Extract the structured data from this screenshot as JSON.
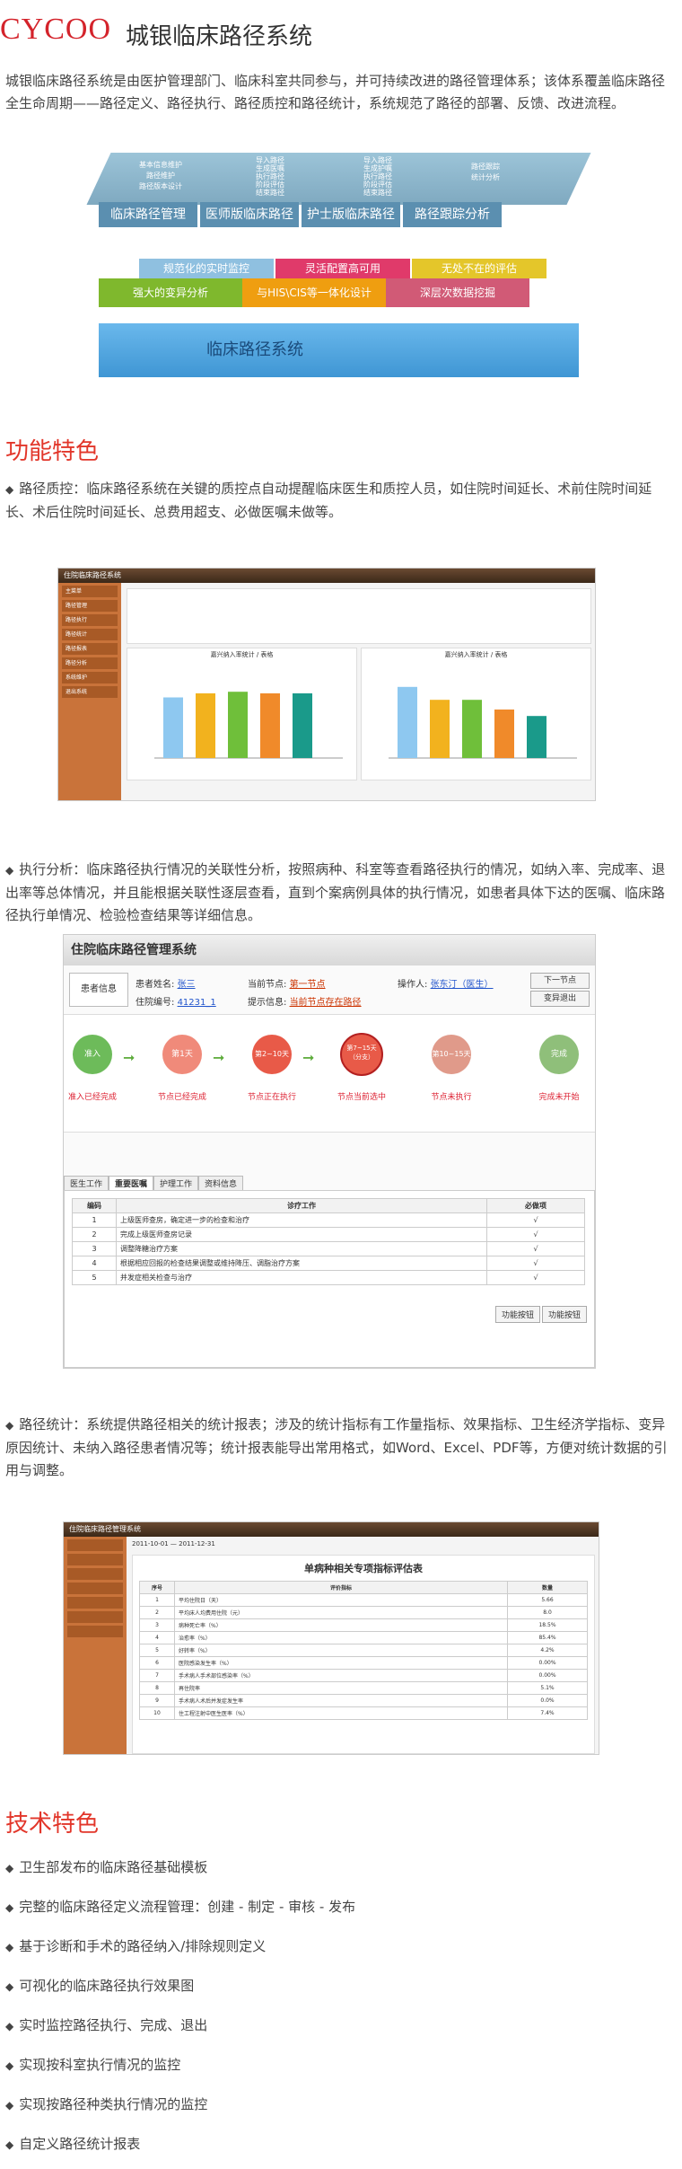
{
  "header": {
    "brand": "CYCOO",
    "title": "城银临床路径系统"
  },
  "intro": "城银临床路径系统是由医护管理部门、临床科室共同参与，并可持续改进的路径管理体系；该体系覆盖临床路径全生命周期——路径定义、路径执行、路径质控和路径统计，系统规范了路径的部署、反馈、改进流程。",
  "arch": {
    "top": [
      "临床路径管理",
      "医师版临床路径",
      "护士版临床路径",
      "路径跟踪分析"
    ],
    "top_sub": [
      [
        "基本信息维护",
        "路径维护",
        "路径版本设计"
      ],
      [
        "导入路径",
        "生成医嘱",
        "执行路径",
        "阶段评估",
        "结束路径"
      ],
      [
        "导入路径",
        "生成护嘱",
        "执行路径",
        "阶段评估",
        "结束路径"
      ],
      [
        "路径跟踪",
        "统计分析"
      ]
    ],
    "mid1": [
      "规范化的实时监控",
      "灵活配置高可用",
      "无处不在的评估"
    ],
    "mid2": [
      "强大的变异分析",
      "与HIS\\CIS等一体化设计",
      "深层次数据挖掘"
    ],
    "base": "临床路径系统",
    "colors": {
      "blue": "#5aa3d6",
      "green": "#8ab832",
      "orange": "#e8a21b",
      "pink": "#d94a6e",
      "yellow": "#d9c028",
      "gray": "#6e9ab0"
    }
  },
  "features": {
    "heading": "功能特色",
    "items": [
      "路径质控：临床路径系统在关键的质控点自动提醒临床医生和质控人员，如住院时间延长、术前住院时间延长、术后住院时间延长、总费用超支、必做医嘱未做等。",
      "执行分析：临床路径执行情况的关联性分析，按照病种、科室等查看路径执行的情况，如纳入率、完成率、退出率等总体情况，并且能根据关联性逐层查看，直到个案病例具体的执行情况，如患者具体下达的医嘱、临床路径执行单情况、检验检查结果等详细信息。",
      "路径统计：系统提供路径相关的统计报表；涉及的统计指标有工作量指标、效果指标、卫生经济学指标、变异原因统计、未纳入路径患者情况等；统计报表能导出常用格式，如Word、Excel、PDF等，方便对统计数据的引用与调整。"
    ]
  },
  "shot1": {
    "title": "住院临床路径系统",
    "nav": [
      "主菜单",
      "路径管理",
      "路径执行",
      "路径统计",
      "路径报表",
      "路径分析",
      "系统维护",
      "退出系统"
    ],
    "chart1": {
      "title": "嘉兴纳入率统计 / 表格",
      "values": [
        75,
        80,
        82,
        80,
        80
      ]
    },
    "chart2": {
      "title": "嘉兴纳入率统计 / 表格",
      "values": [
        88,
        72,
        72,
        60,
        52
      ]
    }
  },
  "shot2": {
    "title": "住院临床路径管理系统",
    "patient_label": "患者信息",
    "name_label": "患者姓名:",
    "name": "张三",
    "node_label": "当前节点:",
    "node": "第一节点",
    "op_label": "操作人:",
    "op": "张东汀（医生）",
    "bed_label": "住院编号:",
    "bed": "41231_1",
    "tip_label": "提示信息:",
    "tip": "当前节点存在路径",
    "btn_next": "下一节点",
    "btn_var": "变异退出",
    "steps": [
      {
        "circle": "准入",
        "label": "准入已经完成"
      },
      {
        "circle": "第1天",
        "label": "节点已经完成"
      },
      {
        "circle": "第2~10天",
        "label": "节点正在执行"
      },
      {
        "circle": "第7~15天（分支）",
        "label": "节点当前选中"
      },
      {
        "circle": "第10~15天",
        "label": "节点未执行"
      },
      {
        "circle": "完成",
        "label": "完成未开始"
      }
    ],
    "tabs": [
      "医生工作",
      "重要医嘱",
      "护理工作",
      "资料信息"
    ],
    "col_no": "编码",
    "col_work": "诊疗工作",
    "col_req": "必做项",
    "rows": [
      [
        "1",
        "上级医师查房，确定进一步的检查和治疗",
        "√"
      ],
      [
        "2",
        "完成上级医师查房记录",
        "√"
      ],
      [
        "3",
        "调整降糖治疗方案",
        "√"
      ],
      [
        "4",
        "根据相应回报的检查结果调整或维持降压、调脂治疗方案",
        "√"
      ],
      [
        "5",
        "并发症相关检查与治疗",
        "√"
      ]
    ],
    "btn_a": "功能按钮",
    "btn_b": "功能按钮"
  },
  "shot3": {
    "title": "住院临床路径管理系统",
    "report_title": "单病种相关专项指标评估表",
    "time1": "2011-10-01",
    "time2": "2011-12-31",
    "col_a": "序号",
    "col_b": "评价指标",
    "col_c": "数量",
    "rows": [
      [
        "1",
        "平均住院日（天）",
        "5.66"
      ],
      [
        "2",
        "平均床人均费用住院（元）",
        "8.0"
      ],
      [
        "3",
        "病种死亡率（%）",
        "18.5%"
      ],
      [
        "4",
        "治愈率（%）",
        "85.4%"
      ],
      [
        "5",
        "好转率（%）",
        "4.2%"
      ],
      [
        "6",
        "医院感染发生率（%）",
        "0.00%"
      ],
      [
        "7",
        "手术病人手术部位感染率（%）",
        "0.00%"
      ],
      [
        "8",
        "再住院率",
        "5.1%"
      ],
      [
        "9",
        "手术病人术后并发症发生率",
        "0.0%"
      ],
      [
        "10",
        "住工程注射中医生医率（%）",
        "7.4%"
      ]
    ]
  },
  "tech": {
    "heading": "技术特色",
    "items": [
      "卫生部发布的临床路径基础模板",
      "完整的临床路径定义流程管理：创建 - 制定 - 审核 - 发布",
      "基于诊断和手术的路径纳入/排除规则定义",
      "可视化的临床路径执行效果图",
      "实时监控路径执行、完成、退出",
      "实现按科室执行情况的监控",
      "实现按路径种类执行情况的监控",
      "自定义路径统计报表"
    ]
  }
}
